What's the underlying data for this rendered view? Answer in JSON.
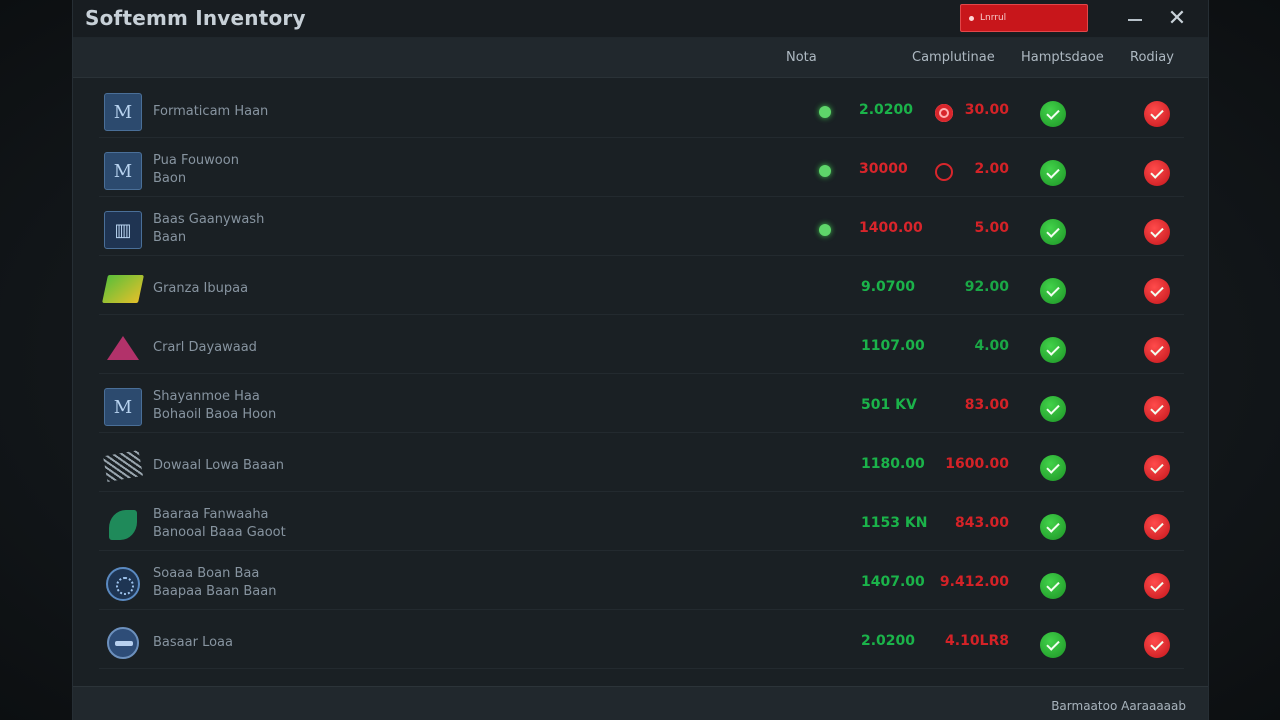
{
  "window": {
    "title": "Softemm Inventory",
    "search_value": "Lnrrul",
    "minimize_label": "",
    "close_symbol": "✕"
  },
  "columns": {
    "nota": "Nota",
    "comp": "Camplutinae",
    "hom": "Hamptsdaoe",
    "rod": "Rodiay"
  },
  "rows": [
    {
      "name_line1": "Formaticam Haan",
      "name_line2": "",
      "icon": "m-tile-icon",
      "status": "online",
      "nota": "2.0200",
      "nota_color": "green",
      "flag": "filled",
      "comp": "30.00",
      "comp_color": "red"
    },
    {
      "name_line1": "Pua Fouwoon",
      "name_line2": "Baon",
      "icon": "m-tile-icon",
      "status": "online",
      "nota": "30000",
      "nota_color": "red",
      "flag": "ring",
      "comp": "2.00",
      "comp_color": "red"
    },
    {
      "name_line1": "Baas Gaanywash",
      "name_line2": "Baan",
      "icon": "bar-chart-icon",
      "status": "online",
      "nota": "1400.00",
      "nota_color": "red",
      "flag": "",
      "comp": "5.00",
      "comp_color": "red"
    },
    {
      "name_line1": "Granza Ibupaa",
      "name_line2": "",
      "icon": "green-cube-icon",
      "status": "",
      "nota": "9.0700",
      "nota_color": "green",
      "flag": "",
      "comp": "92.00",
      "comp_color": "green"
    },
    {
      "name_line1": "Crarl Dayawaad",
      "name_line2": "",
      "icon": "pink-triangle-icon",
      "status": "",
      "nota": "1107.00",
      "nota_color": "green",
      "flag": "",
      "comp": "4.00",
      "comp_color": "green"
    },
    {
      "name_line1": "Shayanmoe Haa",
      "name_line2": "Bohaoil Baoa Hoon",
      "icon": "m-tile-icon",
      "status": "",
      "nota": "501 KV",
      "nota_color": "green",
      "flag": "",
      "comp": "83.00",
      "comp_color": "red"
    },
    {
      "name_line1": "Dowaal Lowa Baaan",
      "name_line2": "",
      "icon": "hatched-icon",
      "status": "",
      "nota": "1180.00",
      "nota_color": "green",
      "flag": "",
      "comp": "1600.00",
      "comp_color": "red"
    },
    {
      "name_line1": "Baaraa Fanwaaha",
      "name_line2": "Banooal Baaa Gaoot",
      "icon": "leaf-icon",
      "status": "",
      "nota": "1153 KN",
      "nota_color": "green",
      "flag": "",
      "comp": "843.00",
      "comp_color": "red"
    },
    {
      "name_line1": "Soaaa Boan Baa",
      "name_line2": "Baapaa Baan Baan",
      "icon": "globe-icon",
      "status": "",
      "nota": "1407.00",
      "nota_color": "green",
      "flag": "",
      "comp": "9.412.00",
      "comp_color": "red"
    },
    {
      "name_line1": "Basaar Loaa",
      "name_line2": "",
      "icon": "pill-icon",
      "status": "",
      "nota": "2.0200",
      "nota_color": "green",
      "flag": "",
      "comp": "4.10LR8",
      "comp_color": "red"
    }
  ],
  "footer": {
    "text": "Barmaatoo Aaraaaaab"
  }
}
